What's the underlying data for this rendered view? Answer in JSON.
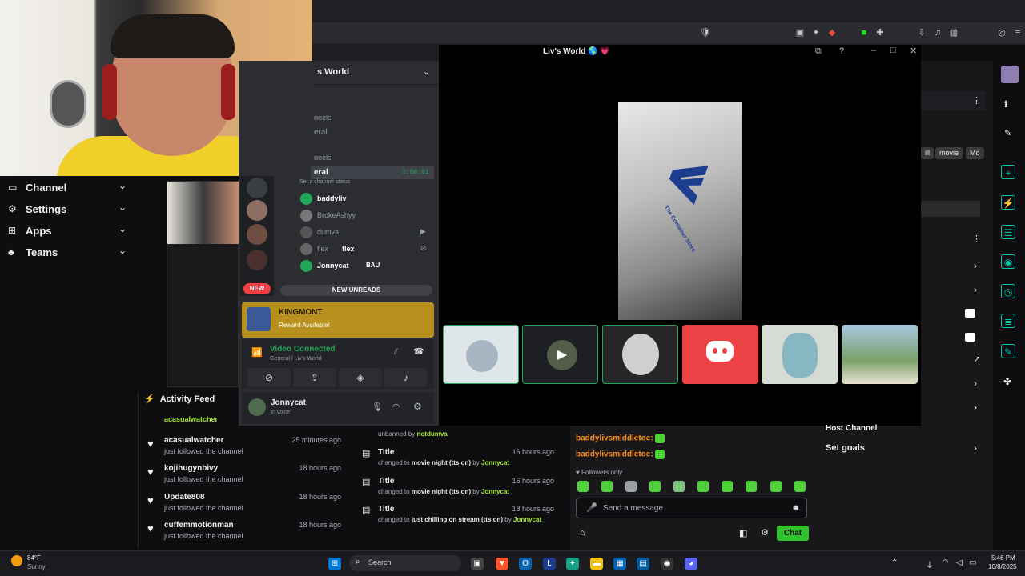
{
  "browser": {
    "window_title": "Liv's World",
    "title_emoji": "🌎 💗"
  },
  "left_nav": {
    "items": [
      {
        "icon": "tv-icon",
        "label": "Channel"
      },
      {
        "icon": "gear-icon",
        "label": "Settings"
      },
      {
        "icon": "grid-icon",
        "label": "Apps"
      },
      {
        "icon": "team-icon",
        "label": "Teams"
      }
    ]
  },
  "activity_feed": {
    "title": "Activity Feed",
    "partial_top": "acasualwatcher",
    "items": [
      {
        "name": "acasualwatcher",
        "action": "just followed the channel",
        "time": "25 minutes ago"
      },
      {
        "name": "kojihugynbivy",
        "action": "just followed the channel",
        "time": "18 hours ago"
      },
      {
        "name": "Update808",
        "action": "just followed the channel",
        "time": "18 hours ago"
      },
      {
        "name": "cuffemmotionman",
        "action": "just followed the channel",
        "time": "18 hours ago"
      }
    ]
  },
  "discord": {
    "server_name": "s World",
    "voice_channel": "eral",
    "voice_timer": "3:08:01",
    "status_placeholder": "Set a channel status",
    "section_label_1": "nnels",
    "section_label_2": "eral",
    "section_label_3": "nnels",
    "users": [
      {
        "name": "baddyliv"
      },
      {
        "name": "BrokeAshyy"
      },
      {
        "name": "dumva"
      },
      {
        "name": "flex",
        "tag": "flex"
      },
      {
        "name": "Jonnycat",
        "tag": "BAU"
      }
    ],
    "new_badge": "NEW",
    "new_unreads": "NEW UNREADS",
    "reward_title": "KINGMONT",
    "reward_text": "Reward Available!",
    "voice_status": "Video Connected",
    "voice_location": "General / Liv's World",
    "user_name": "Jonnycat",
    "user_status": "In voice"
  },
  "call": {
    "main_video_text": "The Container Store"
  },
  "right_panel": {
    "pills": [
      "ill",
      "movie",
      "Mo"
    ],
    "host_channel": "Host Channel",
    "set_goals": "Set goals"
  },
  "chat_log": {
    "top_line": "unbanned by",
    "top_user": "notdumva",
    "items": [
      {
        "title": "Title",
        "time": "16 hours ago",
        "changed": "changed to",
        "value": "movie night (tts on)",
        "by": "by",
        "user": "Jonnycat"
      },
      {
        "title": "Title",
        "time": "16 hours ago",
        "changed": "changed to",
        "value": "movie night (tts on)",
        "by": "by",
        "user": "Jonnycat"
      },
      {
        "title": "Title",
        "time": "18 hours ago",
        "changed": "changed to",
        "value": "just chilling on stream (tts on)",
        "by": "by",
        "user": "Jonnycat"
      }
    ]
  },
  "chat": {
    "lines": [
      "baddylivsmiddletoe:",
      "baddylivsmiddletoe:"
    ],
    "followers_only": "Followers only",
    "placeholder": "Send a message",
    "chat_button": "Chat"
  },
  "taskbar": {
    "weather_temp": "84°F",
    "weather_desc": "Sunny",
    "search": "Search",
    "time": "5:46 PM",
    "date": "10/8/2025"
  }
}
